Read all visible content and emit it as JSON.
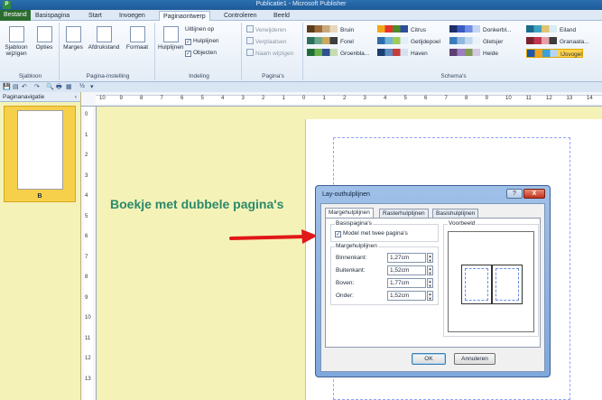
{
  "window": {
    "title": "Publicatie1 - Microsoft Publisher",
    "app_icon_letter": "P"
  },
  "tabs": [
    "Bestand",
    "Basispagina",
    "Start",
    "Invoegen",
    "Paginaontwerp",
    "Controleren",
    "Beeld"
  ],
  "ribbon": {
    "sjabloon": {
      "btn1": "Sjabloon wijzigen",
      "btn2": "Opties",
      "label": "Sjabloon"
    },
    "pagina_instelling": {
      "marges": "Marges",
      "afdrukstand": "Afdrukstand",
      "formaat": "Formaat",
      "label": "Pagina-instelling"
    },
    "indeling": {
      "hulplijnen": "Hulplijnen",
      "uitlijnen_op": "Uitlijnen op",
      "hulplijnen_chk": "Hulplijnen",
      "objecten_chk": "Objecten",
      "label": "Indeling"
    },
    "paginas": {
      "verwijderen": "Verwijderen",
      "verplaatsen": "Verplaatsen",
      "naam_wijzigen": "Naam wijzigen",
      "label": "Pagina's"
    },
    "schema": {
      "label": "Schema's",
      "items": [
        {
          "name": "Bruin",
          "colors": [
            "#5a3b1c",
            "#9b6b3c",
            "#c9a77a",
            "#e8d7bd"
          ]
        },
        {
          "name": "Forel",
          "colors": [
            "#2d6f5d",
            "#6aa88c",
            "#c9a95c",
            "#3e3e3e"
          ]
        },
        {
          "name": "Groenbla...",
          "colors": [
            "#1f6d3a",
            "#6bb04a",
            "#2f4f8f",
            "#c6dcb2"
          ]
        },
        {
          "name": "Citrus",
          "colors": [
            "#f0a81c",
            "#e3342b",
            "#4c8c2b",
            "#2c4f9a"
          ]
        },
        {
          "name": "Getijdepoel",
          "colors": [
            "#2b6caa",
            "#73b3d8",
            "#9fcb58",
            "#e2f0fa"
          ]
        },
        {
          "name": "Haven",
          "colors": [
            "#1a3e6e",
            "#5f8cc1",
            "#c43c3c",
            "#d6e2f0"
          ]
        },
        {
          "name": "Donkerbl...",
          "colors": [
            "#1d2e6b",
            "#3a5ac3",
            "#6e8de3",
            "#c6d3f3"
          ]
        },
        {
          "name": "Gletsjer",
          "colors": [
            "#3a7bbd",
            "#8fb8df",
            "#c4d9ee",
            "#e9f1fa"
          ]
        },
        {
          "name": "Heide",
          "colors": [
            "#5d3f74",
            "#a07cc1",
            "#7e9c52",
            "#d6c8e2"
          ]
        },
        {
          "name": "Eiland",
          "colors": [
            "#1a6b8c",
            "#3fa1c2",
            "#e2c46e",
            "#d7ecf3"
          ]
        },
        {
          "name": "Granaata...",
          "colors": [
            "#7c1f2e",
            "#c0374d",
            "#e7a0a9",
            "#3d3d3d"
          ]
        },
        {
          "name": "IJsvogel",
          "colors": [
            "#1e58a6",
            "#f0a11e",
            "#3aa0d9",
            "#b5d6f1"
          ]
        }
      ]
    }
  },
  "qat": [
    "💾",
    "▤",
    "↶",
    "↷",
    "🔍",
    "🖶",
    "▦",
    "½",
    "▾"
  ],
  "nav": {
    "header": "Paginanavigatie",
    "collapse": "‹",
    "page_label": "B"
  },
  "ruler": {
    "h_ticks": [
      "10",
      "9",
      "8",
      "7",
      "6",
      "5",
      "4",
      "3",
      "2",
      "1",
      "0",
      "1",
      "2",
      "3",
      "4",
      "5",
      "6",
      "7",
      "8",
      "9",
      "10",
      "11",
      "12",
      "13",
      "14"
    ],
    "v_ticks": [
      "0",
      "1",
      "2",
      "3",
      "4",
      "5",
      "6",
      "7",
      "8",
      "9",
      "10",
      "11",
      "12",
      "13"
    ]
  },
  "annotation": "Boekje met dubbele pagina's",
  "dialog": {
    "title": "Lay-outhulplijnen",
    "help": "?",
    "close": "X",
    "tabs": [
      "Margehulplijnen",
      "Rasterhulplijnen",
      "Basishulplijnen"
    ],
    "basispaginas_legend": "Basispagina's",
    "model_checkbox": "Model met twee pagina's",
    "margehulplijnen_legend": "Margehulplijnen",
    "fields": [
      {
        "label": "Binnenkant:",
        "value": "1,27cm"
      },
      {
        "label": "Buitenkant:",
        "value": "1,52cm"
      },
      {
        "label": "Boven:",
        "value": "1,77cm"
      },
      {
        "label": "Onder:",
        "value": "1,52cm"
      }
    ],
    "voorbeeld_legend": "Voorbeeld",
    "ok": "OK",
    "cancel": "Annuleren"
  }
}
